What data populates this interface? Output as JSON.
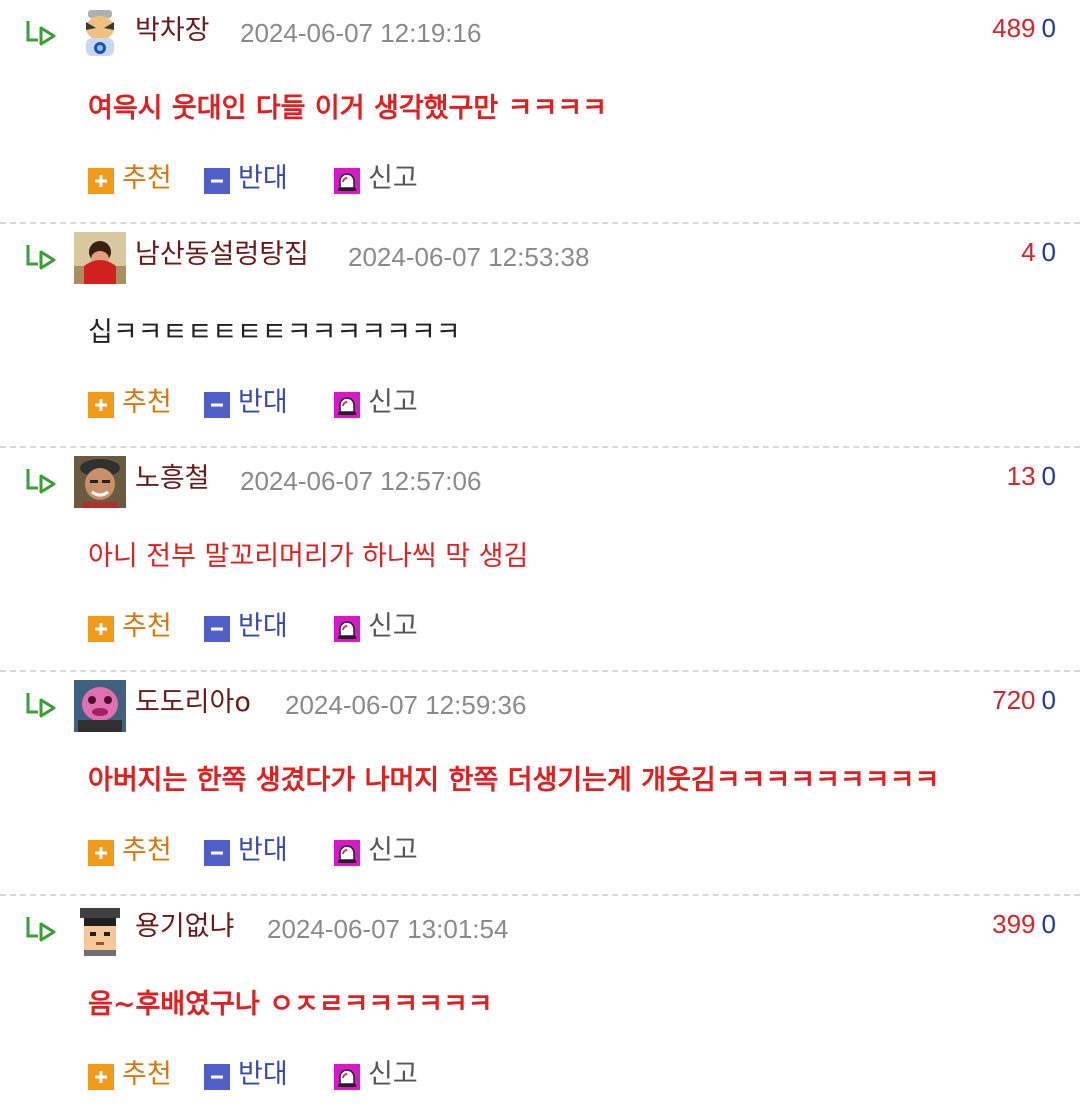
{
  "actions": {
    "upvote_label": "추천",
    "downvote_label": "반대",
    "report_label": "신고"
  },
  "icons": {
    "reply": "reply-arrow-icon",
    "upvote": "plus-icon",
    "downvote": "minus-icon",
    "report": "siren-icon"
  },
  "colors": {
    "nickname": "#6b1a1a",
    "timestamp": "#8a8a8a",
    "upvote_count": "#d8232a",
    "downvote_count": "#1f35a8",
    "hot_comment_text": "#e02020",
    "plain_text": "#222222",
    "reply_icon": "#3aa035",
    "upvote_icon": "#f29a1a",
    "downvote_icon": "#5060c8",
    "report_icon": "#d916c8"
  },
  "comments": [
    {
      "nickname": "박차장",
      "timestamp": "2024-06-07 12:19:16",
      "upvotes": "489",
      "downvotes": "0",
      "text": "여윽시 웃대인 다들 이거 생각했구만 ㅋㅋㅋㅋ",
      "text_style": "hot",
      "avatar": "robot-mascot-avatar"
    },
    {
      "nickname": "남산동설렁탕집",
      "timestamp": "2024-06-07 12:53:38",
      "upvotes": "4",
      "downvotes": "0",
      "text": "십ㅋㅋㅌㅌㅌㅌㅌㅋㅋㅋㅋㅋㅋㅋ",
      "text_style": "plain",
      "avatar": "photo-avatar"
    },
    {
      "nickname": "노흥철",
      "timestamp": "2024-06-07 12:57:06",
      "upvotes": "13",
      "downvotes": "0",
      "text": "아니 전부 말꼬리머리가 하나씩 막 생김",
      "text_style": "red",
      "avatar": "photo-avatar"
    },
    {
      "nickname": "도도리아o",
      "timestamp": "2024-06-07 12:59:36",
      "upvotes": "720",
      "downvotes": "0",
      "text": "아버지는 한쪽 생겼다가 나머지 한쪽 더생기는게 개웃김ㅋㅋㅋㅋㅋㅋㅋㅋㅋ",
      "text_style": "hot",
      "avatar": "pink-character-avatar"
    },
    {
      "nickname": "용기없냐",
      "timestamp": "2024-06-07 13:01:54",
      "upvotes": "399",
      "downvotes": "0",
      "text": "음~후배였구나 ㅇㅈㄹㅋㅋㅋㅋㅋㅋ",
      "text_style": "hot",
      "avatar": "pixel-character-avatar"
    }
  ]
}
